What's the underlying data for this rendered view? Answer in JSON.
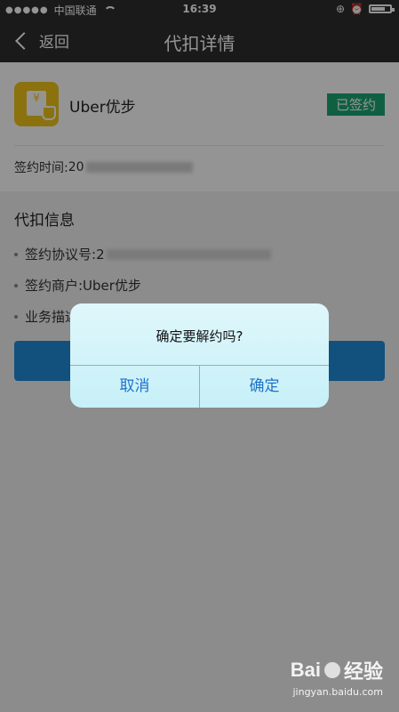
{
  "status_bar": {
    "carrier": "中国联通",
    "time": "16:39"
  },
  "navbar": {
    "back_label": "返回",
    "title": "代扣详情"
  },
  "merchant": {
    "name": "Uber优步",
    "status_badge": "已签约",
    "sign_time_label": "签约时间:",
    "sign_time_visible": "20"
  },
  "info": {
    "title": "代扣信息",
    "agreement_label": "签约协议号:",
    "agreement_visible": "2",
    "merchant_label": "签约商户:Uber优步",
    "business_label": "业务描述"
  },
  "dialog": {
    "message": "确定要解约吗?",
    "cancel": "取消",
    "confirm": "确定"
  },
  "watermark": {
    "brand": "Bai",
    "brand2": "经验",
    "site": "jingyan.baidu.com"
  },
  "colors": {
    "badge": "#1aa672",
    "logo": "#f0c419",
    "dialog_text": "#1e72c7"
  }
}
